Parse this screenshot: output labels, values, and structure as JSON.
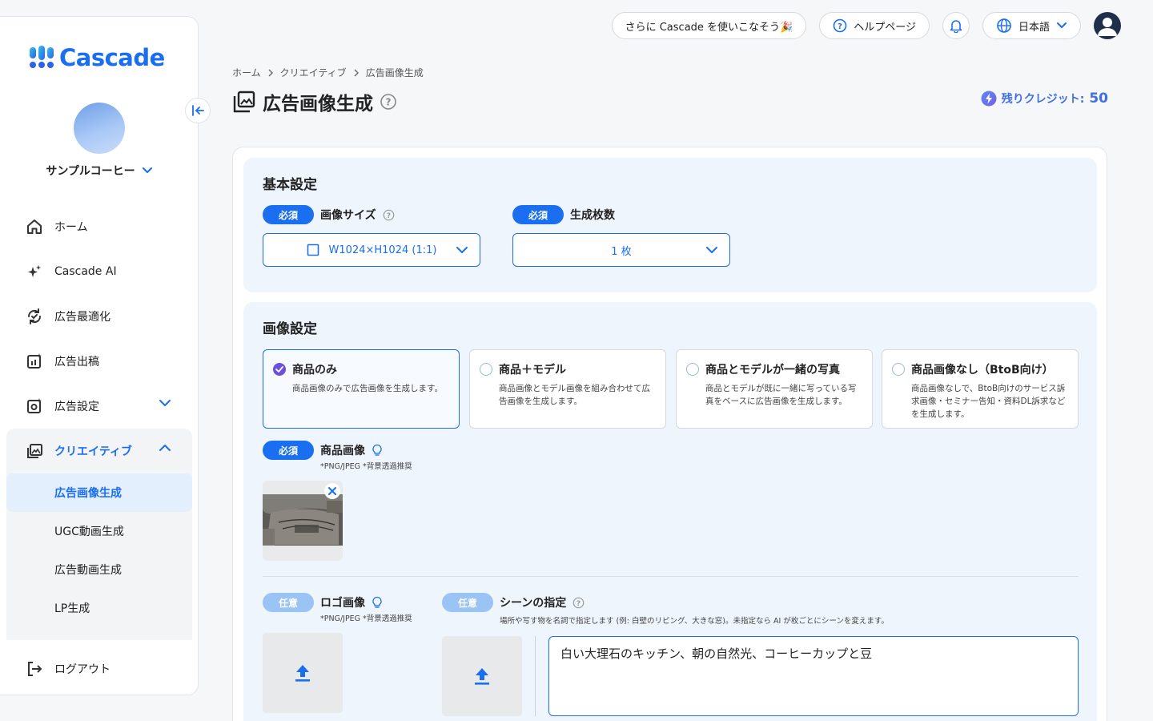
{
  "app": {
    "logo_text": "Cascade"
  },
  "sidebar": {
    "org_name": "サンプルコーヒー",
    "items": [
      {
        "label": "ホーム",
        "icon": "home-icon"
      },
      {
        "label": "Cascade AI",
        "icon": "sparkle-icon"
      },
      {
        "label": "広告最適化",
        "icon": "optimize-icon"
      },
      {
        "label": "広告出稿",
        "icon": "publish-icon"
      },
      {
        "label": "広告設定",
        "icon": "ad-settings-icon"
      }
    ],
    "creative": {
      "label": "クリエイティブ",
      "sub_items": [
        "広告画像生成",
        "UGC動画生成",
        "広告動画生成",
        "LP生成"
      ]
    },
    "logout_label": "ログアウト"
  },
  "topbar": {
    "promo_label": "さらに Cascade を使いこなそう🎉",
    "help_label": "ヘルプページ",
    "language_label": "日本語"
  },
  "breadcrumb": [
    "ホーム",
    "クリエイティブ",
    "広告画像生成"
  ],
  "page": {
    "title": "広告画像生成"
  },
  "credits": {
    "label": "残りクレジット:",
    "value": "50"
  },
  "basic_settings": {
    "title": "基本設定",
    "required_badge": "必須",
    "image_size": {
      "label": "画像サイズ",
      "value": "W1024×H1024 (1:1)"
    },
    "count": {
      "label": "生成枚数",
      "value": "1 枚"
    }
  },
  "image_settings": {
    "title": "画像設定",
    "options": [
      {
        "title": "商品のみ",
        "desc": "商品画像のみで広告画像を生成します。",
        "selected": true
      },
      {
        "title": "商品＋モデル",
        "desc": "商品画像とモデル画像を組み合わせて広告画像を生成します。",
        "selected": false
      },
      {
        "title": "商品とモデルが一緒の写真",
        "desc": "商品とモデルが既に一緒に写っている写真をベースに広告画像を生成します。",
        "selected": false
      },
      {
        "title": "商品画像なし（BtoB向け）",
        "desc": "商品画像なしで、BtoB向けのサービス訴求画像・セミナー告知・資料DL訴求などを生成します。",
        "selected": false
      }
    ],
    "product_image": {
      "badge": "必須",
      "label": "商品画像",
      "hint": "*PNG/JPEG *背景透過推奨"
    },
    "logo_image": {
      "badge": "任意",
      "label": "ロゴ画像",
      "hint": "*PNG/JPEG *背景透過推奨"
    },
    "scene": {
      "badge": "任意",
      "label": "シーンの指定",
      "hint": "場所や写す物を名詞で指定します (例: 白壁のリビング、大きな窓)。未指定なら AI が枚ごとにシーンを変えます。",
      "value": "白い大理石のキッチン、朝の自然光、コーヒーカップと豆"
    }
  },
  "colors": {
    "accent": "#1a6ef0",
    "section_bg": "#eff5fc",
    "radio_selected": "#6b4fe0"
  }
}
